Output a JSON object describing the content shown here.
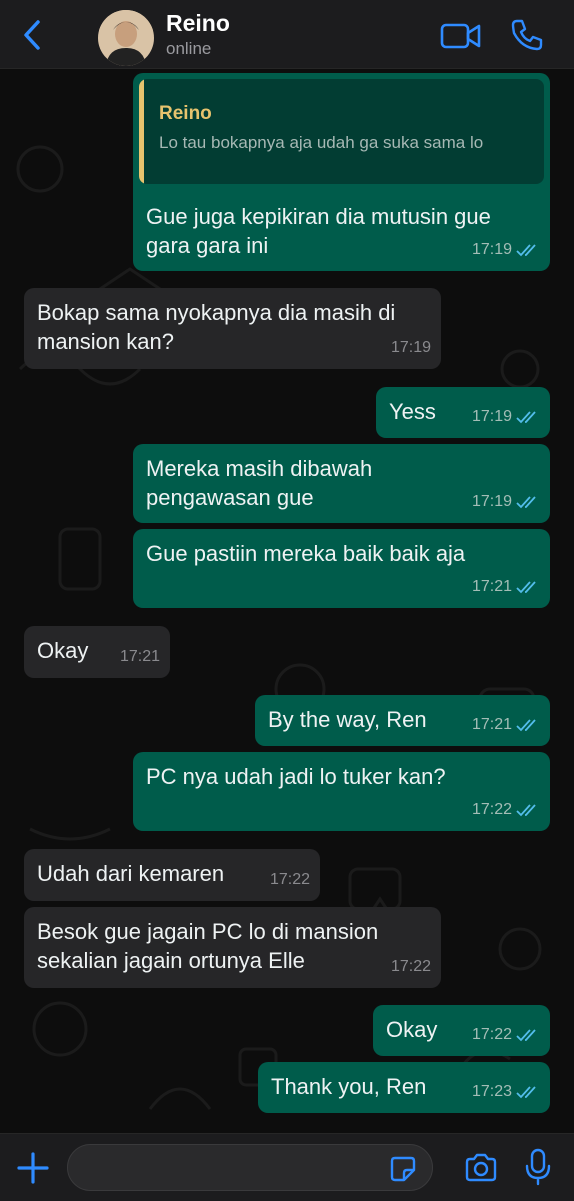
{
  "header": {
    "contact_name": "Reino",
    "status": "online",
    "icons": [
      "chevron-left-icon",
      "avatar",
      "video-call-icon",
      "phone-icon"
    ],
    "accent_color": "#2f8bff"
  },
  "messages": [
    {
      "dir": "out",
      "reply": {
        "name": "Reino",
        "text": "Lo tau bokapnya aja udah ga suka sama lo"
      },
      "lines": [
        "Gue juga kepikiran dia mutusin gue",
        "gara gara ini"
      ],
      "time": "17:19",
      "read": true
    },
    {
      "dir": "in",
      "lines": [
        "Bokap sama nyokapnya dia masih di",
        "mansion kan?"
      ],
      "time": "17:19"
    },
    {
      "dir": "out",
      "lines": [
        "Yess"
      ],
      "time": "17:19",
      "read": true
    },
    {
      "dir": "out",
      "lines": [
        "Mereka masih dibawah",
        "pengawasan gue"
      ],
      "time": "17:19",
      "read": true
    },
    {
      "dir": "out",
      "lines": [
        "Gue pastiin mereka baik baik aja"
      ],
      "time": "17:21",
      "read": true
    },
    {
      "dir": "in",
      "lines": [
        "Okay"
      ],
      "time": "17:21"
    },
    {
      "dir": "out",
      "lines": [
        "By the way, Ren"
      ],
      "time": "17:21",
      "read": true
    },
    {
      "dir": "out",
      "lines": [
        "PC nya udah jadi lo tuker kan?"
      ],
      "time": "17:22",
      "read": true
    },
    {
      "dir": "in",
      "lines": [
        "Udah dari kemaren"
      ],
      "time": "17:22"
    },
    {
      "dir": "in",
      "lines": [
        "Besok gue jagain PC lo di mansion",
        "sekalian jagain ortunya Elle"
      ],
      "time": "17:22"
    },
    {
      "dir": "out",
      "lines": [
        "Okay"
      ],
      "time": "17:22",
      "read": true
    },
    {
      "dir": "out",
      "lines": [
        "Thank you, Ren"
      ],
      "time": "17:23",
      "read": true
    }
  ],
  "bubble_colors": {
    "out": "#005c4b",
    "in": "#262628",
    "read_ticks": "#53bdeb"
  },
  "composer": {
    "input_value": "",
    "input_placeholder": "",
    "icons": [
      "plus-icon",
      "sticker-icon",
      "camera-icon",
      "microphone-icon"
    ]
  }
}
